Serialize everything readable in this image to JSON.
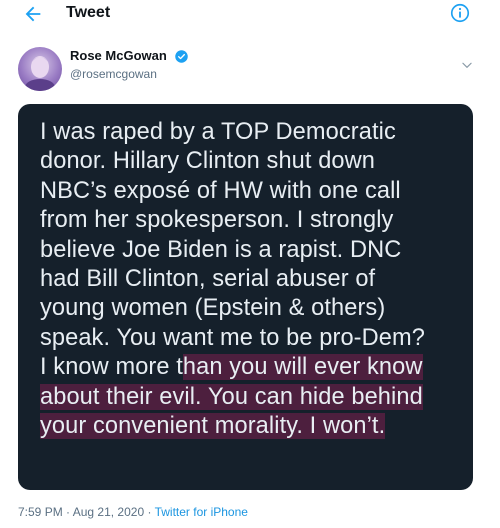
{
  "header": {
    "title": "Tweet",
    "back_icon": "arrow-left-icon",
    "info_icon": "info-icon"
  },
  "colors": {
    "accent": "#1da1f2",
    "media_bg": "#15202b",
    "highlight": "#4d1f3e"
  },
  "author": {
    "name": "Rose McGowan",
    "handle": "@rosemcgowan",
    "verified": true
  },
  "media_text": {
    "lines": [
      "I was raped by a TOP Democratic",
      "donor. Hillary Clinton shut down",
      "NBC’s exposé of HW with one call",
      "from her spokesperson. I strongly",
      "believe Joe Biden is a rapist. DNC",
      "had Bill Clinton, serial abuser of",
      "young women (Epstein & others)",
      "speak. You want me to be pro-Dem?"
    ],
    "line9_plain": "I know more t",
    "line9_highlight": "han you will ever know",
    "line10_highlight": "about their evil. You can hide behind",
    "line11_highlight": "your convenient morality. I won’t."
  },
  "meta": {
    "time": "7:59 PM",
    "sep1": " · ",
    "date": "Aug 21, 2020",
    "sep2": " · ",
    "source": "Twitter for iPhone"
  }
}
